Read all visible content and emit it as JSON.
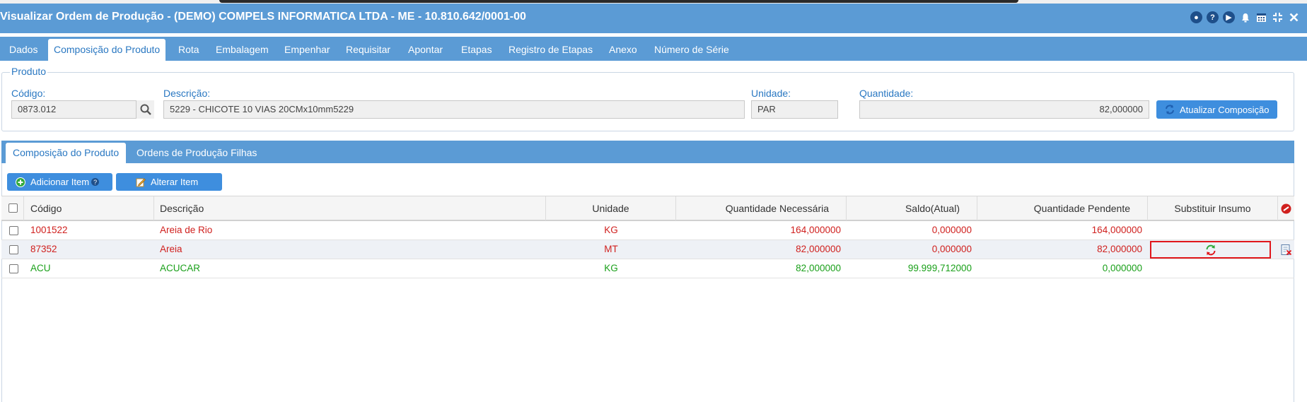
{
  "window": {
    "title": "Visualizar Ordem de Produção - (DEMO) COMPELS INFORMATICA LTDA - ME - 10.810.642/0001-00",
    "icons": [
      "record-icon",
      "help-icon",
      "play-icon",
      "bell-icon",
      "calendar-icon",
      "collapse-icon",
      "close-icon"
    ]
  },
  "main_tabs": [
    {
      "label": "Dados",
      "active": false
    },
    {
      "label": "Composição do Produto",
      "active": true
    },
    {
      "label": "Rota",
      "active": false
    },
    {
      "label": "Embalagem",
      "active": false
    },
    {
      "label": "Empenhar",
      "active": false
    },
    {
      "label": "Requisitar",
      "active": false
    },
    {
      "label": "Apontar",
      "active": false
    },
    {
      "label": "Etapas",
      "active": false
    },
    {
      "label": "Registro de Etapas",
      "active": false
    },
    {
      "label": "Anexo",
      "active": false
    },
    {
      "label": "Número de Série",
      "active": false
    }
  ],
  "produto": {
    "legend": "Produto",
    "codigo_label": "Código:",
    "codigo_value": "0873.012",
    "descricao_label": "Descrição:",
    "descricao_value": "5229 - CHICOTE 10 VIAS 20CMx10mm5229",
    "unidade_label": "Unidade:",
    "unidade_value": "PAR",
    "quantidade_label": "Quantidade:",
    "quantidade_value": "82,000000",
    "atualizar_label": "Atualizar Composição"
  },
  "sub_tabs": [
    {
      "label": "Composição do Produto",
      "active": true
    },
    {
      "label": "Ordens de Produção Filhas",
      "active": false
    }
  ],
  "toolbar": {
    "adicionar_label": "Adicionar Item",
    "alterar_label": "Alterar Item"
  },
  "grid": {
    "columns": [
      "Código",
      "Descrição",
      "Unidade",
      "Quantidade Necessária",
      "Saldo(Atual)",
      "Quantidade Pendente",
      "Substituir Insumo"
    ],
    "rows": [
      {
        "codigo": "1001522",
        "descricao": "Areia de Rio",
        "unidade": "KG",
        "necessaria": "164,000000",
        "saldo": "0,000000",
        "pendente": "164,000000",
        "status": "red"
      },
      {
        "codigo": "87352",
        "descricao": "Areia",
        "unidade": "MT",
        "necessaria": "82,000000",
        "saldo": "0,000000",
        "pendente": "82,000000",
        "status": "red"
      },
      {
        "codigo": "ACU",
        "descricao": "ACUCAR",
        "unidade": "KG",
        "necessaria": "82,000000",
        "saldo": "99.999,712000",
        "pendente": "0,000000",
        "status": "green"
      }
    ]
  },
  "colors": {
    "header_blue": "#5b9bd5",
    "button_blue": "#3e8ede",
    "label_blue": "#2a78c2",
    "row_red": "#d0201e",
    "row_green": "#1aa01a",
    "highlight_border": "#e0161c"
  }
}
